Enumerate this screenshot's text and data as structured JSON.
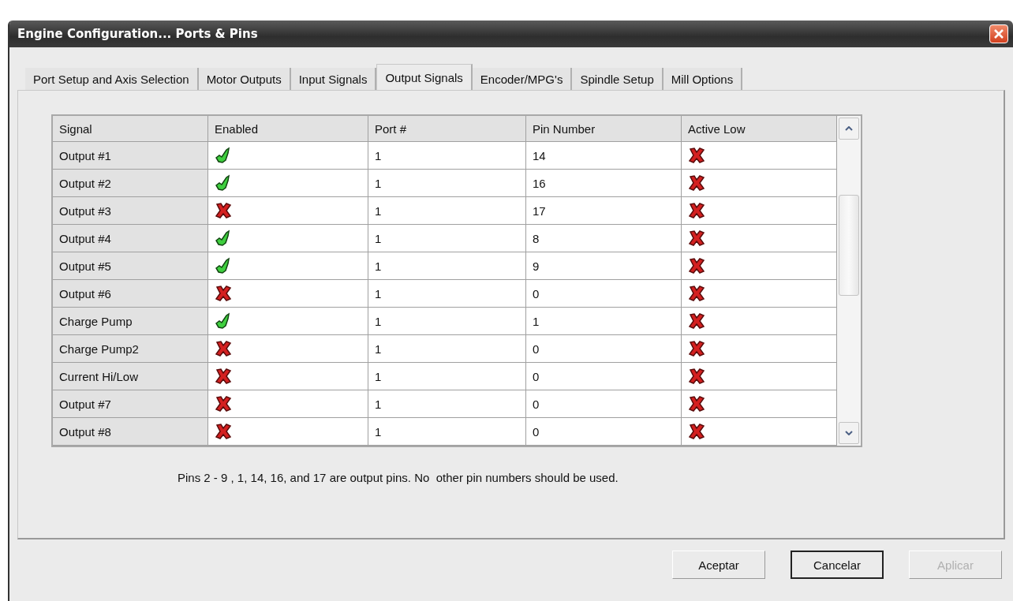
{
  "window": {
    "title": "Engine Configuration... Ports & Pins"
  },
  "tabs": [
    {
      "label": "Port Setup and Axis Selection",
      "selected": false
    },
    {
      "label": "Motor Outputs",
      "selected": false
    },
    {
      "label": "Input Signals",
      "selected": false
    },
    {
      "label": "Output Signals",
      "selected": true
    },
    {
      "label": "Encoder/MPG's",
      "selected": false
    },
    {
      "label": "Spindle Setup",
      "selected": false
    },
    {
      "label": "Mill Options",
      "selected": false
    }
  ],
  "table": {
    "columns": [
      "Signal",
      "Enabled",
      "Port #",
      "Pin Number",
      "Active Low"
    ],
    "rows": [
      {
        "signal": "Output #1",
        "enabled": true,
        "port": "1",
        "pin": "14",
        "active_low": false
      },
      {
        "signal": "Output #2",
        "enabled": true,
        "port": "1",
        "pin": "16",
        "active_low": false
      },
      {
        "signal": "Output #3",
        "enabled": false,
        "port": "1",
        "pin": "17",
        "active_low": false
      },
      {
        "signal": "Output #4",
        "enabled": true,
        "port": "1",
        "pin": "8",
        "active_low": false
      },
      {
        "signal": "Output #5",
        "enabled": true,
        "port": "1",
        "pin": "9",
        "active_low": false
      },
      {
        "signal": "Output #6",
        "enabled": false,
        "port": "1",
        "pin": "0",
        "active_low": false
      },
      {
        "signal": "Charge Pump",
        "enabled": true,
        "port": "1",
        "pin": "1",
        "active_low": false
      },
      {
        "signal": "Charge Pump2",
        "enabled": false,
        "port": "1",
        "pin": "0",
        "active_low": false
      },
      {
        "signal": "Current Hi/Low",
        "enabled": false,
        "port": "1",
        "pin": "0",
        "active_low": false
      },
      {
        "signal": "Output #7",
        "enabled": false,
        "port": "1",
        "pin": "0",
        "active_low": false
      },
      {
        "signal": "Output #8",
        "enabled": false,
        "port": "1",
        "pin": "0",
        "active_low": false
      }
    ]
  },
  "note": "Pins 2 - 9 , 1, 14, 16, and 17 are output pins. No  other pin numbers should be used.",
  "buttons": [
    {
      "label": "Aceptar",
      "default": false,
      "disabled": false
    },
    {
      "label": "Cancelar",
      "default": true,
      "disabled": false
    },
    {
      "label": "Aplicar",
      "default": false,
      "disabled": true
    }
  ]
}
